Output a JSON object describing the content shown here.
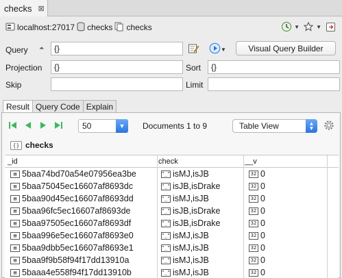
{
  "tab": {
    "title": "checks",
    "close": "⊠"
  },
  "breadcrumb": {
    "server": "localhost:27017",
    "database": "checks",
    "collection": "checks"
  },
  "labels": {
    "query": "Query",
    "projection": "Projection",
    "sort": "Sort",
    "skip": "Skip",
    "limit": "Limit",
    "query_sort_marker": "⏶"
  },
  "fields": {
    "query": "{}",
    "projection": "{}",
    "sort": "{}",
    "skip": "",
    "limit": ""
  },
  "buttons": {
    "visual_query_builder": "Visual Query Builder"
  },
  "result_tabs": [
    "Result",
    "Query Code",
    "Explain"
  ],
  "pager": {
    "page_size": "50",
    "documents_info": "Documents 1 to 9",
    "view_mode": "Table View"
  },
  "collection_name": "checks",
  "table": {
    "columns": [
      "_id",
      "check",
      "__v"
    ],
    "rows": [
      {
        "id": "5baa74bd70a54e07956ea3be",
        "check": "isMJ,isJB",
        "v": "0"
      },
      {
        "id": "5baa75045ec16607af8693dc",
        "check": "isJB,isDrake",
        "v": "0"
      },
      {
        "id": "5baa90d45ec16607af8693dd",
        "check": "isMJ,isJB",
        "v": "0"
      },
      {
        "id": "5baa96fc5ec16607af8693de",
        "check": "isJB,isDrake",
        "v": "0"
      },
      {
        "id": "5baa97505ec16607af8693df",
        "check": "isJB,isDrake",
        "v": "0"
      },
      {
        "id": "5baa996e5ec16607af8693e0",
        "check": "isMJ,isJB",
        "v": "0"
      },
      {
        "id": "5baa9dbb5ec16607af8693e1",
        "check": "isMJ,isJB",
        "v": "0"
      },
      {
        "id": "5baa9f9b58f94f17dd13910a",
        "check": "isMJ,isJB",
        "v": "0"
      },
      {
        "id": "5baaa4e558f94f17dd13910b",
        "check": "isMJ,isJB",
        "v": "0"
      }
    ]
  },
  "icons": {
    "id_cell": "id-card-icon",
    "string_cell": "string-icon",
    "number_cell": "int32-icon"
  },
  "colors": {
    "accent": "#2a74e0",
    "nav_green": "#3cb95b"
  }
}
